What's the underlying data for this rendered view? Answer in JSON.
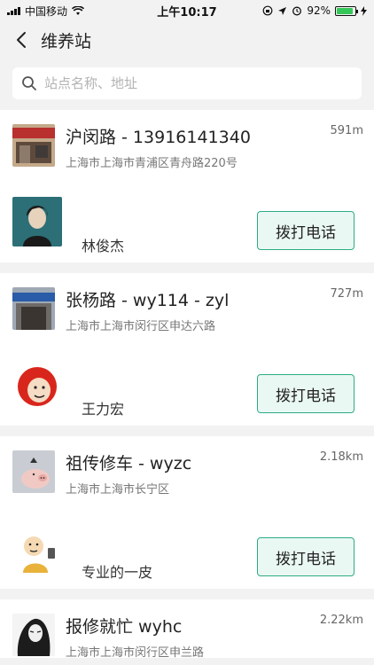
{
  "status_bar": {
    "carrier": "中国移动",
    "time": "上午10:17",
    "battery": "92%",
    "battery_level": 0.92
  },
  "header": {
    "title": "维养站"
  },
  "search": {
    "placeholder": "站点名称、地址"
  },
  "stations": [
    {
      "name": "沪闵路 - 13916141340",
      "address": "上海市上海市青浦区青舟路220号",
      "distance": "591m",
      "person": "林俊杰",
      "call_label": "拨打电话"
    },
    {
      "name": "张杨路 - wy114 - zyl",
      "address": "上海市上海市闵行区申达六路",
      "distance": "727m",
      "person": "王力宏",
      "call_label": "拨打电话"
    },
    {
      "name": "祖传修车 - wyzc",
      "address": "上海市上海市长宁区",
      "distance": "2.18km",
      "person": "专业的一皮",
      "call_label": "拨打电话"
    },
    {
      "name": "报修就忙 wyhc",
      "address": "上海市上海市闵行区申兰路",
      "distance": "2.22km"
    }
  ],
  "colors": {
    "accent": "#2dab84",
    "button_bg": "#eaf8f3",
    "page_bg": "#f2f2f2"
  }
}
